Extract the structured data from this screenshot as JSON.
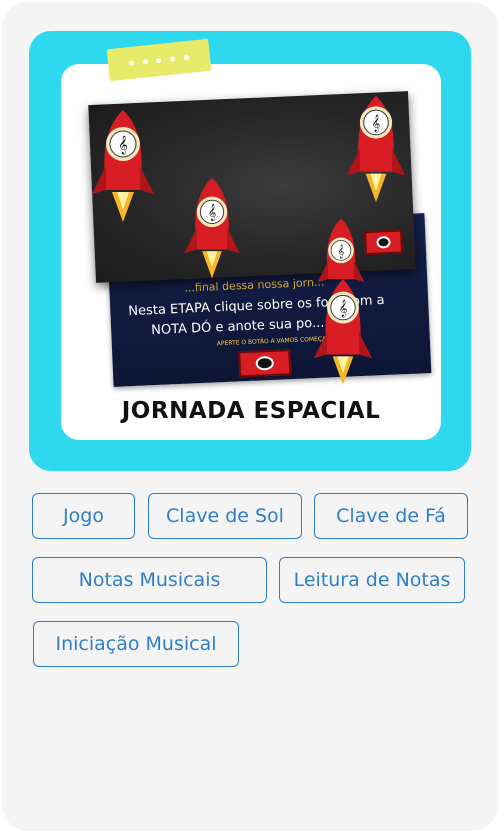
{
  "card": {
    "image_alt": "Jornada Espacial",
    "title": "JORNADA ESPACIAL",
    "screen_top_text": "...final dessa nossa jorn...",
    "screen_line1": "Nesta ETAPA clique sobre os fo...  com a",
    "screen_line2": "NOTA  DÓ e anote sua po...   io!",
    "screen_small": "APERTE O BOTÃO A VAMOS COMEÇAR!"
  },
  "tags": [
    {
      "label": "Jogo"
    },
    {
      "label": "Clave de Sol"
    },
    {
      "label": "Clave de Fá"
    },
    {
      "label": "Notas Musicais"
    },
    {
      "label": "Leitura de Notas"
    },
    {
      "label": "Iniciação Musical"
    }
  ],
  "colors": {
    "hero_bg": "#2ed8ef",
    "tape": "#e8ea6a",
    "tag_border": "#2f7fc6",
    "card_bg": "#f4f4f4"
  }
}
